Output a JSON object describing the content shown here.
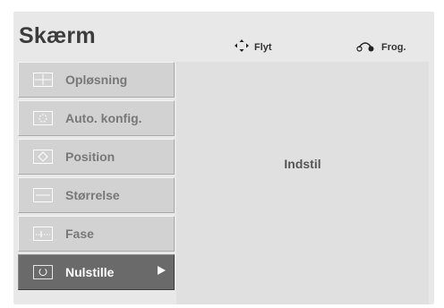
{
  "menu_title": "Skærm",
  "hints": {
    "move_label": "Flyt",
    "back_label": "Frog."
  },
  "menu_items": [
    {
      "label": "Opløsning",
      "icon": "resolution-icon"
    },
    {
      "label": "Auto. konfig.",
      "icon": "auto-config-icon"
    },
    {
      "label": "Position",
      "icon": "position-icon"
    },
    {
      "label": "Størrelse",
      "icon": "size-icon"
    },
    {
      "label": "Fase",
      "icon": "phase-icon"
    },
    {
      "label": "Nulstille",
      "icon": "reset-icon",
      "selected": true
    }
  ],
  "panel_label": "Indstil"
}
